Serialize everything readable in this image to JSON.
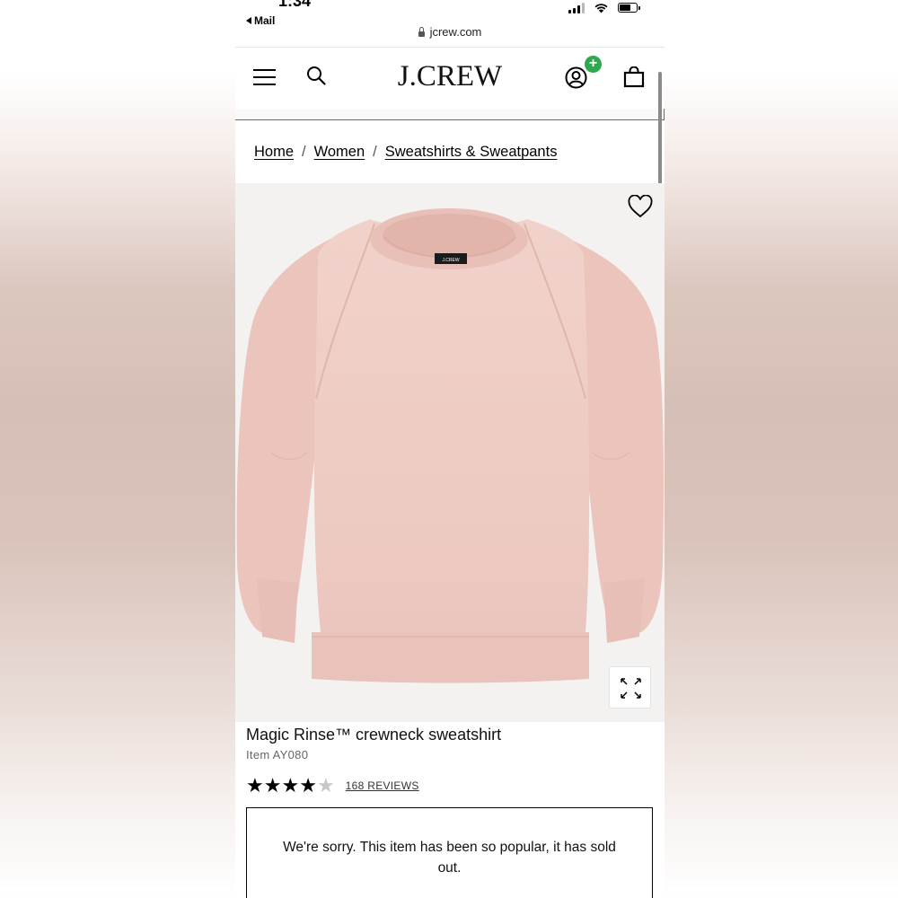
{
  "status_bar": {
    "time": "1:34",
    "back_app": "Mail",
    "url": "jcrew.com"
  },
  "header": {
    "logo": "J.CREW",
    "menu_icon": "hamburger-menu-icon",
    "search_icon": "search-icon",
    "account_icon": "account-icon",
    "account_badge": "+",
    "bag_icon": "shopping-bag-icon"
  },
  "breadcrumb": {
    "items": [
      "Home",
      "Women",
      "Sweatshirts & Sweatpants"
    ],
    "separator": "/"
  },
  "product": {
    "image_alt": "pink crewneck sweatshirt",
    "label_text": "J.CREW",
    "title": "Magic Rinse™ crewneck sweatshirt",
    "item_number": "Item AY080",
    "rating": 4,
    "rating_max": 5,
    "reviews_label": "168 REVIEWS",
    "sold_out_message": "We're sorry. This item has been so popular, it has sold out."
  },
  "colors": {
    "badge_green": "#2fa84f",
    "promo_line_red": "#c94040",
    "sweatshirt_pink": "#efcdc6"
  }
}
